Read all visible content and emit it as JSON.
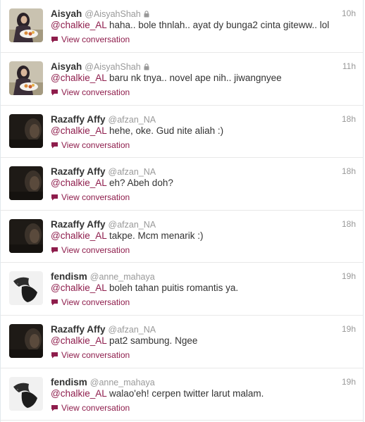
{
  "colors": {
    "accent": "#8e1d4c",
    "muted": "#999999",
    "text": "#333333",
    "border": "#e8e8e8"
  },
  "view_conversation_label": "View conversation",
  "tweets": [
    {
      "name": "Aisyah",
      "handle": "@AisyahShah",
      "protected": true,
      "time": "10h",
      "mention": "@chalkie_AL",
      "text": " haha.. bole thnlah.. ayat dy bunga2 cinta giteww.. lol",
      "avatar": "aisyah-avatar"
    },
    {
      "name": "Aisyah",
      "handle": "@AisyahShah",
      "protected": true,
      "time": "11h",
      "mention": "@chalkie_AL",
      "text": " baru nk tnya.. novel ape nih.. jiwangnyee",
      "avatar": "aisyah-avatar"
    },
    {
      "name": "Razaffy Affy",
      "handle": "@afzan_NA",
      "protected": false,
      "time": "18h",
      "mention": "@chalkie_AL",
      "text": " hehe, oke. Gud nite aliah :)",
      "avatar": "razaffy-avatar"
    },
    {
      "name": "Razaffy Affy",
      "handle": "@afzan_NA",
      "protected": false,
      "time": "18h",
      "mention": "@chalkie_AL",
      "text": " eh? Abeh doh?",
      "avatar": "razaffy-avatar"
    },
    {
      "name": "Razaffy Affy",
      "handle": "@afzan_NA",
      "protected": false,
      "time": "18h",
      "mention": "@chalkie_AL",
      "text": " takpe. Mcm menarik :)",
      "avatar": "razaffy-avatar"
    },
    {
      "name": "fendism",
      "handle": "@anne_mahaya",
      "protected": false,
      "time": "19h",
      "mention": "@chalkie_AL",
      "text": " boleh tahan puitis romantis ya.",
      "avatar": "fendism-avatar"
    },
    {
      "name": "Razaffy Affy",
      "handle": "@afzan_NA",
      "protected": false,
      "time": "19h",
      "mention": "@chalkie_AL",
      "text": " pat2 sambung. Ngee",
      "avatar": "razaffy-avatar"
    },
    {
      "name": "fendism",
      "handle": "@anne_mahaya",
      "protected": false,
      "time": "19h",
      "mention": "@chalkie_AL",
      "text": " walao'eh! cerpen twitter larut malam.",
      "avatar": "fendism-avatar"
    }
  ]
}
